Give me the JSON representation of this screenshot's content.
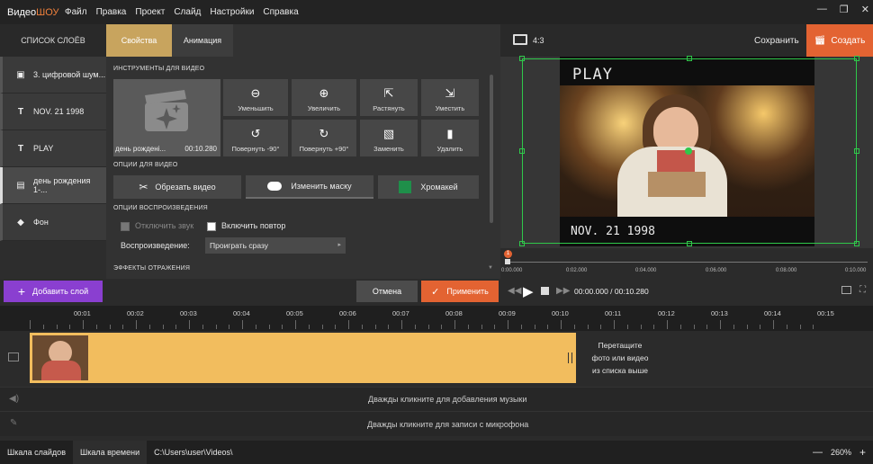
{
  "app": {
    "logo_a": "Видео",
    "logo_b": "ШОУ"
  },
  "menu": [
    "Файл",
    "Правка",
    "Проект",
    "Слайд",
    "Настройки",
    "Справка"
  ],
  "window": {
    "minimize": "—",
    "maximize": "❐",
    "close": "✕"
  },
  "layers": {
    "title": "СПИСОК СЛОЁВ",
    "items": [
      {
        "icon": "image-icon",
        "label": "3. цифровой шум..."
      },
      {
        "icon": "text-icon",
        "label": "NOV. 21 1998"
      },
      {
        "icon": "text-icon",
        "label": "PLAY"
      },
      {
        "icon": "video-icon",
        "label": "день рождения 1-...",
        "selected": true
      },
      {
        "icon": "fill-icon",
        "label": "Фон"
      }
    ]
  },
  "tabs": {
    "props": "Свойства",
    "anim": "Анимация"
  },
  "video_tools": {
    "section": "ИНСТРУМЕНТЫ ДЛЯ ВИДЕО",
    "thumb_name": "день рожденi...",
    "thumb_duration": "00:10.280",
    "buttons": [
      {
        "label": "Уменьшить",
        "icon": "zoom-out-icon"
      },
      {
        "label": "Увеличить",
        "icon": "zoom-in-icon"
      },
      {
        "label": "Растянуть",
        "icon": "stretch-icon"
      },
      {
        "label": "Уместить",
        "icon": "fit-icon"
      },
      {
        "label": "Повернуть -90°",
        "icon": "rotate-left-icon"
      },
      {
        "label": "Повернуть +90°",
        "icon": "rotate-right-icon"
      },
      {
        "label": "Заменить",
        "icon": "replace-icon"
      },
      {
        "label": "Удалить",
        "icon": "trash-icon"
      }
    ]
  },
  "video_options": {
    "section": "ОПЦИИ ДЛЯ ВИДЕО",
    "trim": "Обрезать видео",
    "mask": "Изменить маску",
    "chroma": "Хромакей"
  },
  "playback": {
    "section": "ОПЦИИ ВОСПРОИЗВЕДЕНИЯ",
    "mute": "Отключить звук",
    "loop": "Включить повтор",
    "mode_label": "Воспроизведение:",
    "mode_value": "Проиграть сразу"
  },
  "reflection": {
    "section": "ЭФФЕКТЫ ОТРАЖЕНИЯ"
  },
  "preview_bar": {
    "ratio": "4:3",
    "save": "Сохранить",
    "create": "Создать"
  },
  "preview": {
    "overlay_top": "PLAY",
    "overlay_bottom": "NOV. 21 1998"
  },
  "scrub": {
    "marker": "1",
    "ticks": [
      "0:00.000",
      "0:02.000",
      "0:04.000",
      "0:06.000",
      "0:08.000",
      "0:10.000"
    ]
  },
  "controls": {
    "add_layer": "Добавить слой",
    "cancel": "Отмена",
    "apply": "Применить",
    "time": "00:00.000 / 00:10.280"
  },
  "ruler": [
    "00:01",
    "00:02",
    "00:03",
    "00:04",
    "00:05",
    "00:06",
    "00:07",
    "00:08",
    "00:09",
    "00:10",
    "00:11",
    "00:12",
    "00:13",
    "00:14",
    "00:15"
  ],
  "timeline": {
    "drop_hint": [
      "Перетащите",
      "фото или видео",
      "из списка выше"
    ],
    "music_hint": "Дважды кликните для добавления музыки",
    "mic_hint": "Дважды кликните для записи с микрофона"
  },
  "status": {
    "slides": "Шкала слайдов",
    "timeline": "Шкала времени",
    "path": "C:\\Users\\user\\Videos\\",
    "zoom": "260%",
    "minus": "—",
    "plus": "+"
  },
  "colors": {
    "accent": "#e36332",
    "gold": "#c8a45e",
    "purple": "#8a3fd0",
    "selection": "#2fc84a",
    "clip": "#f2bd5e"
  }
}
